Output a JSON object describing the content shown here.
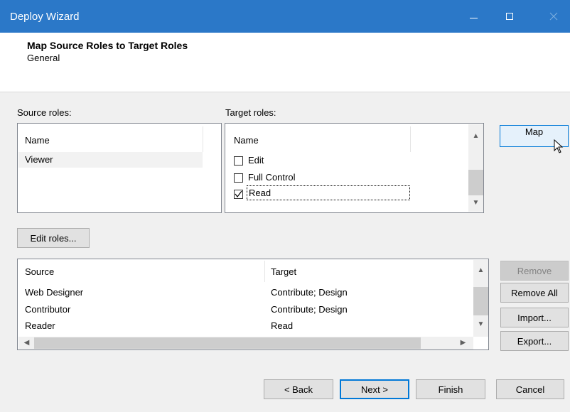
{
  "window": {
    "title": "Deploy Wizard",
    "colors": {
      "titlebar": "#2b78c8",
      "accent": "#0078d7"
    }
  },
  "header": {
    "title": "Map Source Roles to Target Roles",
    "subtitle": "General"
  },
  "source_roles": {
    "label": "Source roles:",
    "column": "Name",
    "items": [
      "Viewer"
    ],
    "selected": "Viewer"
  },
  "target_roles": {
    "label": "Target roles:",
    "column": "Name",
    "items": [
      {
        "label": "Edit",
        "checked": false
      },
      {
        "label": "Full Control",
        "checked": false
      },
      {
        "label": "Read",
        "checked": true
      }
    ]
  },
  "buttons": {
    "map": "Map",
    "edit_roles": "Edit roles...",
    "remove": "Remove",
    "remove_all": "Remove All",
    "import": "Import...",
    "export": "Export...",
    "back": "< Back",
    "next": "Next >",
    "finish": "Finish",
    "cancel": "Cancel"
  },
  "mappings": {
    "columns": [
      "Source",
      "Target"
    ],
    "rows": [
      {
        "source": "Web Designer",
        "target": "Contribute; Design"
      },
      {
        "source": "Contributor",
        "target": "Contribute; Design"
      },
      {
        "source": "Reader",
        "target": "Read"
      }
    ]
  },
  "icons": {
    "minimize": "minimize-icon",
    "maximize": "maximize-icon",
    "close": "close-icon",
    "cursor": "mouse-cursor-icon"
  }
}
